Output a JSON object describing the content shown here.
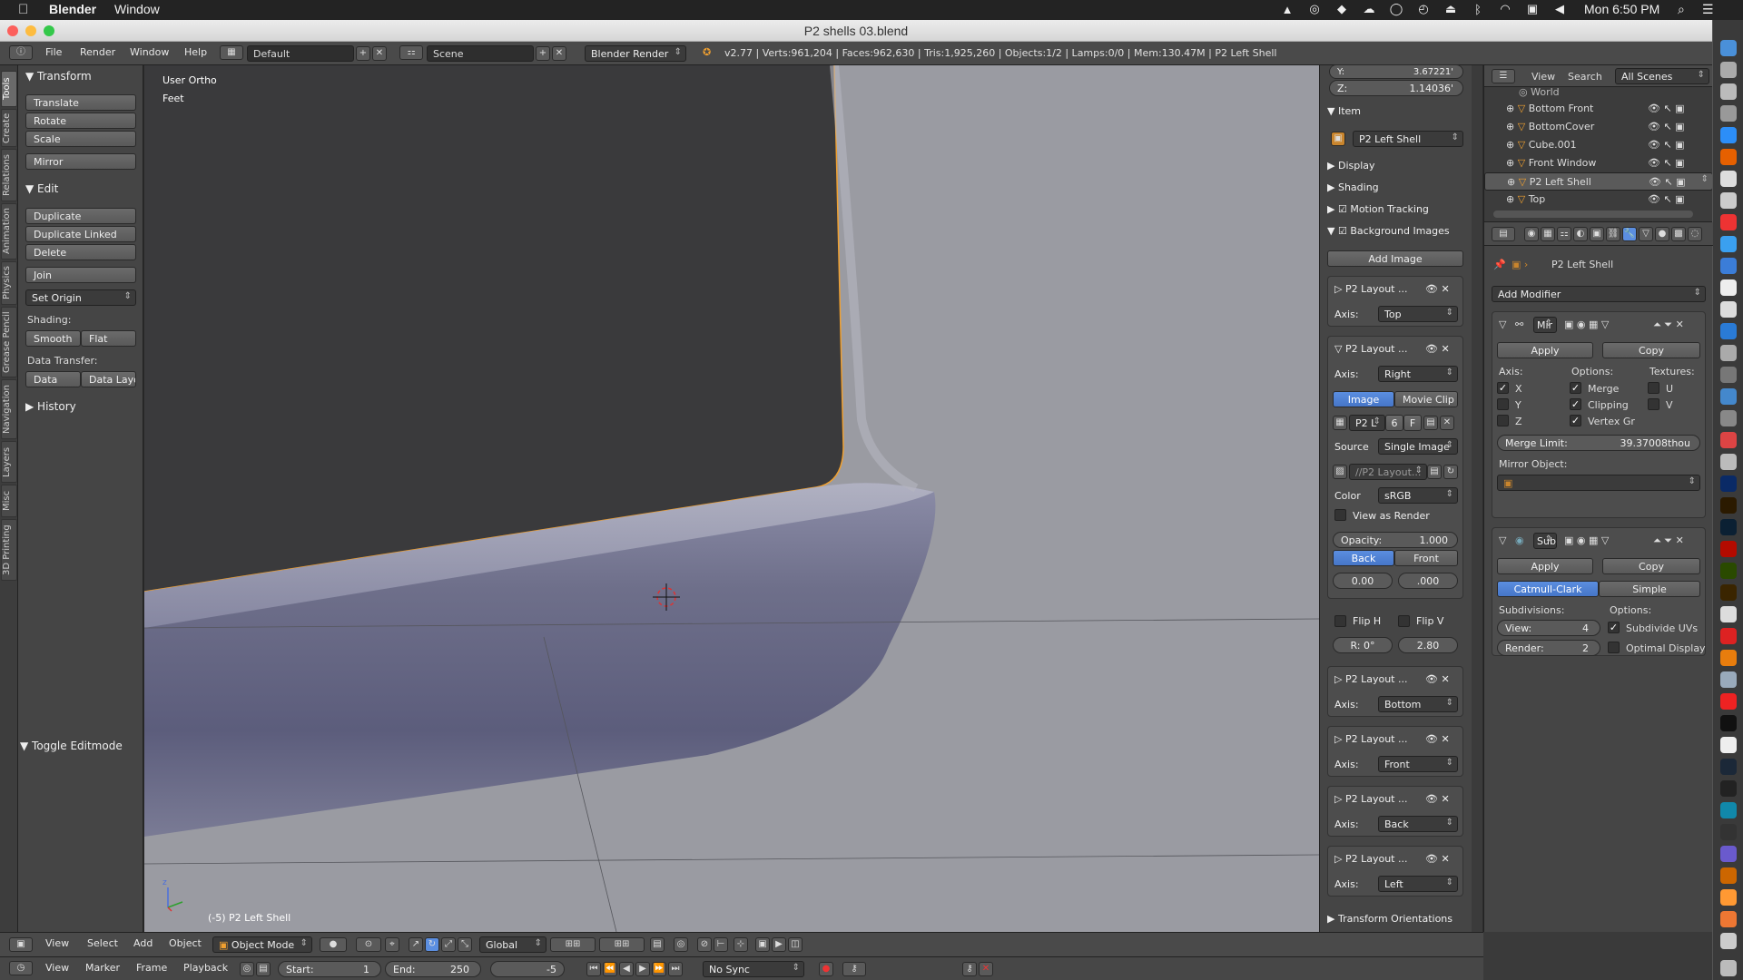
{
  "menubar": {
    "apple": "",
    "app_name": "Blender",
    "menu_window": "Window",
    "clock": "Mon 6:50 PM"
  },
  "window": {
    "title": "P2 shells 03.blend"
  },
  "header": {
    "menus": [
      "File",
      "Render",
      "Window",
      "Help"
    ],
    "layout": "Default",
    "scene": "Scene",
    "engine": "Blender Render",
    "info": "v2.77 | Verts:961,204 | Faces:962,630 | Tris:1,925,260 | Objects:1/2 | Lamps:0/0 | Mem:130.47M | P2 Left Shell"
  },
  "tool_tabs": [
    "Tools",
    "Create",
    "Relations",
    "Animation",
    "Physics",
    "Grease Pencil",
    "Navigation",
    "Layers",
    "Misc",
    "3D Printing"
  ],
  "tools": {
    "transform_title": "Transform",
    "translate": "Translate",
    "rotate": "Rotate",
    "scale": "Scale",
    "mirror": "Mirror",
    "edit_title": "Edit",
    "duplicate": "Duplicate",
    "duplicate_linked": "Duplicate Linked",
    "delete": "Delete",
    "join": "Join",
    "set_origin": "Set Origin",
    "shading_label": "Shading:",
    "smooth": "Smooth",
    "flat": "Flat",
    "data_transfer_label": "Data Transfer:",
    "data": "Data",
    "data_layo": "Data Layo",
    "history_title": "History",
    "toggle_editmode": "Toggle Editmode"
  },
  "viewport": {
    "view_name": "User Ortho",
    "units": "Feet",
    "object_label": "(-5) P2 Left Shell",
    "axis_z": "z",
    "colors": {
      "background": "#9a9ba2",
      "dark_plane": "#3a3a3c",
      "shell": "#6e6f8a",
      "selection_outline": "#f0a030"
    }
  },
  "npanel": {
    "y_label": "Y:",
    "y_value": "3.67221'",
    "z_label": "Z:",
    "z_value": "1.14036'",
    "item_title": "Item",
    "item_name": "P2 Left Shell",
    "display_title": "Display",
    "shading_title": "Shading",
    "motion_tracking_title": "Motion Tracking",
    "background_images_title": "Background Images",
    "add_image": "Add Image",
    "axis_label": "Axis:",
    "image_btn": "Image",
    "movie_clip_btn": "Movie Clip",
    "image_name": "P2 L",
    "image_users": "6",
    "image_f": "F",
    "source_label": "Source",
    "source_value": "Single Image",
    "path_placeholder": "//P2 Layout...",
    "color_label": "Color",
    "color_value": "sRGB",
    "view_as_render": "View as Render",
    "opacity_label": "Opacity:",
    "opacity_value": "1.000",
    "back_btn": "Back",
    "front_btn": "Front",
    "offset_x": "0.00",
    "offset_y": ".000",
    "flip_h": "Flip H",
    "flip_v": "Flip V",
    "rotation": "R: 0°",
    "size": "2.80",
    "transform_orientations": "Transform Orientations",
    "bg_images": [
      {
        "name": "P2 Layout ...",
        "axis": "Top",
        "expanded": false
      },
      {
        "name": "P2 Layout ...",
        "axis": "Right",
        "expanded": true
      },
      {
        "name": "P2 Layout ...",
        "axis": "Bottom",
        "expanded": false
      },
      {
        "name": "P2 Layout ...",
        "axis": "Front",
        "expanded": false
      },
      {
        "name": "P2 Layout ...",
        "axis": "Back",
        "expanded": false
      },
      {
        "name": "P2 Layout ...",
        "axis": "Left",
        "expanded": false
      }
    ]
  },
  "outliner": {
    "view": "View",
    "search": "Search",
    "scope": "All Scenes",
    "items": [
      {
        "name": "World",
        "selected": false
      },
      {
        "name": "Bottom Front",
        "selected": false
      },
      {
        "name": "BottomCover",
        "selected": false
      },
      {
        "name": "Cube.001",
        "selected": false
      },
      {
        "name": "Front Window",
        "selected": false
      },
      {
        "name": "P2 Left Shell",
        "selected": true
      },
      {
        "name": "Top",
        "selected": false
      }
    ]
  },
  "properties": {
    "object_name": "P2 Left Shell",
    "add_modifier": "Add Modifier",
    "mirror": {
      "name": "Mir",
      "apply": "Apply",
      "copy": "Copy",
      "axis_label": "Axis:",
      "options_label": "Options:",
      "textures_label": "Textures:",
      "x": "X",
      "y": "Y",
      "z": "Z",
      "merge": "Merge",
      "clipping": "Clipping",
      "vertex_gr": "Vertex Gr",
      "u": "U",
      "v": "V",
      "merge_limit_label": "Merge Limit:",
      "merge_limit_value": "39.37008thou",
      "mirror_object_label": "Mirror Object:"
    },
    "subsurf": {
      "name": "Sub",
      "apply": "Apply",
      "copy": "Copy",
      "catmull": "Catmull-Clark",
      "simple": "Simple",
      "subdivisions_label": "Subdivisions:",
      "options_label": "Options:",
      "view_label": "View:",
      "view_value": "4",
      "render_label": "Render:",
      "render_value": "2",
      "subdivide_uvs": "Subdivide UVs",
      "optimal_display": "Optimal Display"
    }
  },
  "view_header": {
    "menus": [
      "View",
      "Select",
      "Add",
      "Object"
    ],
    "mode": "Object Mode",
    "orientation": "Global"
  },
  "timeline": {
    "menus": [
      "View",
      "Marker",
      "Frame",
      "Playback"
    ],
    "start_label": "Start:",
    "start_value": "1",
    "end_label": "End:",
    "end_value": "250",
    "current": "-5",
    "sync": "No Sync"
  }
}
